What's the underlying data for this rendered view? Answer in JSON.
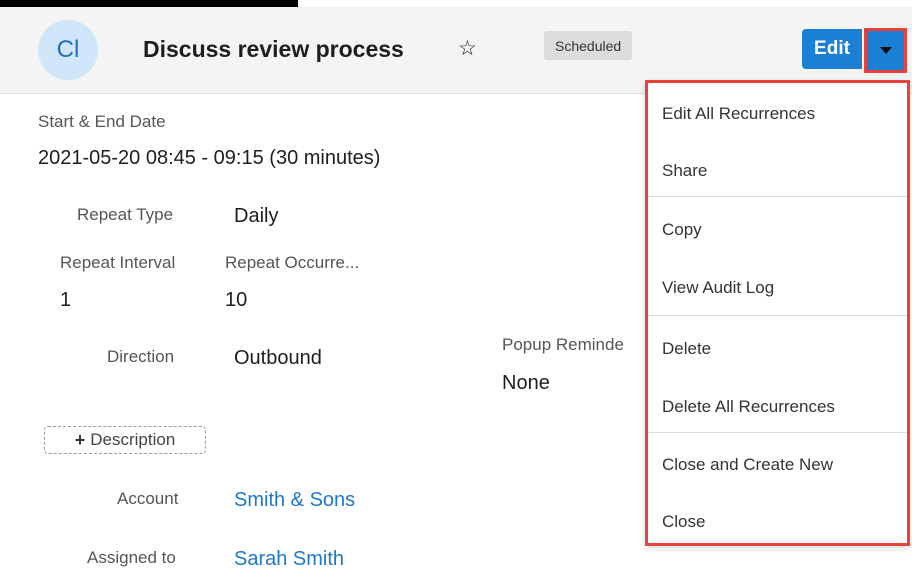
{
  "header": {
    "avatar_initials": "Cl",
    "title": "Discuss review process",
    "status_badge": "Scheduled",
    "edit_label": "Edit"
  },
  "fields": {
    "start_end_label": "Start & End Date",
    "start_end_value": "2021-05-20 08:45 - 09:15 (30 minutes)",
    "repeat_type_label": "Repeat Type",
    "repeat_type_value": "Daily",
    "repeat_interval_label": "Repeat Interval",
    "repeat_interval_value": "1",
    "repeat_occurrences_label": "Repeat Occurre...",
    "repeat_occurrences_value": "10",
    "direction_label": "Direction",
    "direction_value": "Outbound",
    "popup_reminder_label": "Popup Reminde",
    "popup_reminder_value": "None",
    "description_button": "Description",
    "account_label": "Account",
    "account_value": "Smith & Sons",
    "assigned_label": "Assigned to",
    "assigned_value": "Sarah Smith"
  },
  "menu": {
    "items": [
      "Edit All Recurrences",
      "Share",
      "Copy",
      "View Audit Log",
      "Delete",
      "Delete All Recurrences",
      "Close and Create New",
      "Close"
    ]
  },
  "colors": {
    "accent": "#1a7fd5",
    "highlight": "#e8423a",
    "link": "#1f77c9"
  },
  "icons": {
    "favorite": "star-outline-icon",
    "dropdown": "caret-down-icon",
    "add": "plus-icon"
  }
}
